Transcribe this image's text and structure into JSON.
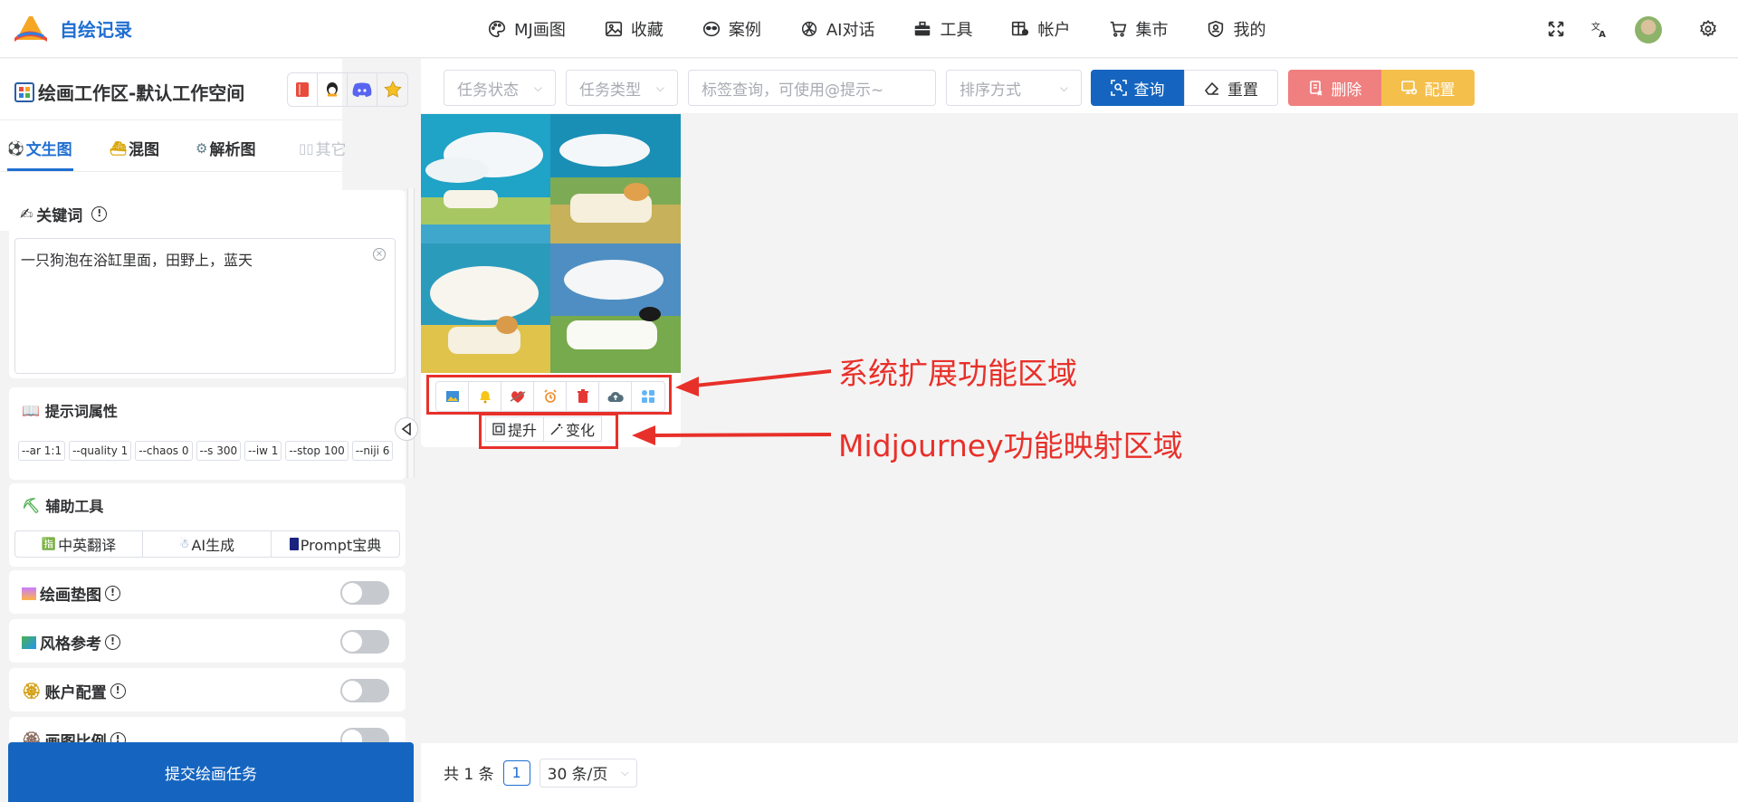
{
  "app": {
    "title": "自绘记录"
  },
  "nav": [
    {
      "label": "MJ画图",
      "icon": "palette-icon"
    },
    {
      "label": "收藏",
      "icon": "image-icon"
    },
    {
      "label": "案例",
      "icon": "alien-icon"
    },
    {
      "label": "AI对话",
      "icon": "openai-icon"
    },
    {
      "label": "工具",
      "icon": "toolbox-icon"
    },
    {
      "label": "帐户",
      "icon": "account-table-icon"
    },
    {
      "label": "集市",
      "icon": "cart-icon"
    },
    {
      "label": "我的",
      "icon": "user-shield-icon"
    }
  ],
  "top_right": {
    "icons": [
      "fullscreen-icon",
      "translate-icon",
      "avatar",
      "settings-icon"
    ]
  },
  "sidebar": {
    "workspace_title": "绘画工作区-默认工作空间",
    "quick_icons": [
      "book-icon",
      "qq-icon",
      "discord-icon",
      "star-icon"
    ],
    "tabs": [
      {
        "label": "文生图",
        "state": "active"
      },
      {
        "label": "混图",
        "state": "normal"
      },
      {
        "label": "解析图",
        "state": "normal"
      },
      {
        "label": "其它",
        "state": "disabled"
      }
    ],
    "keyword": {
      "title": "关键词",
      "value": "一只狗泡在浴缸里面，田野上，蓝天"
    },
    "prompt_attrs": {
      "title": "提示词属性",
      "chips": [
        "--ar 1:1",
        "--quality 1",
        "--chaos 0",
        "--s 300",
        "--iw 1",
        "--stop 100",
        "--niji 6"
      ]
    },
    "aux_tools": {
      "title": "辅助工具",
      "buttons": [
        "中英翻译",
        "AI生成",
        "Prompt宝典"
      ]
    },
    "toggles": [
      {
        "label": "绘画垫图",
        "on": false
      },
      {
        "label": "风格参考",
        "on": false
      },
      {
        "label": "账户配置",
        "on": false
      },
      {
        "label": "画图比例",
        "on": false
      }
    ],
    "submit_label": "提交绘画任务"
  },
  "filters": {
    "status_placeholder": "任务状态",
    "type_placeholder": "任务类型",
    "tag_placeholder": "标签查询，可使用@提示~",
    "sort_placeholder": "排序方式",
    "search_label": "查询",
    "reset_label": "重置",
    "delete_label": "删除",
    "config_label": "配置"
  },
  "task_card": {
    "ext_icons": [
      "picture-icon",
      "bell-icon",
      "heart-icon",
      "alarm-icon",
      "trash-icon",
      "cloud-upload-icon",
      "grid-icon"
    ],
    "mj_buttons": [
      "提升",
      "变化"
    ]
  },
  "annotations": {
    "system_ext": "系统扩展功能区域",
    "mj_map": "Midjourney功能映射区域"
  },
  "pager": {
    "total_text": "共 1 条",
    "current_page": "1",
    "page_size": "30 条/页"
  },
  "colors": {
    "primary": "#1f6fd1",
    "danger": "#f07f7f",
    "warning": "#f5bf4c",
    "annotation": "#e8302a"
  }
}
